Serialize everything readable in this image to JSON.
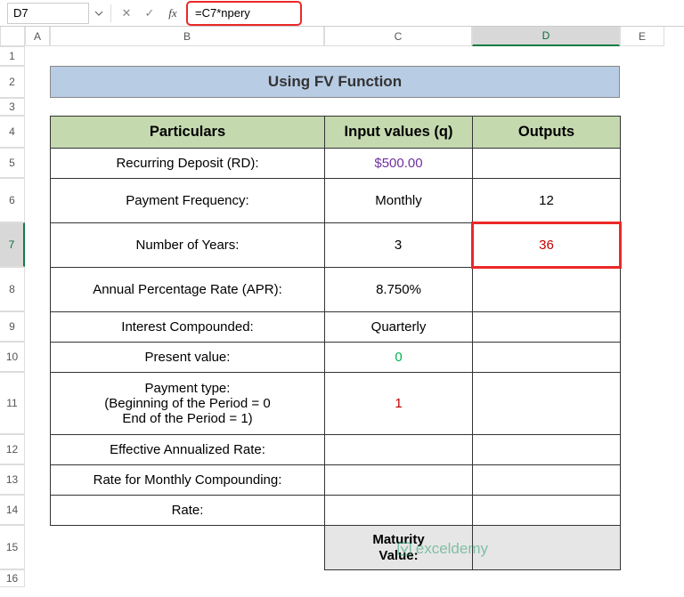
{
  "formula_bar": {
    "cell_ref": "D7",
    "formula": "=C7*npery"
  },
  "col_headers": {
    "A": "A",
    "B": "B",
    "C": "C",
    "D": "D",
    "E": "E"
  },
  "row_headers": [
    "1",
    "2",
    "3",
    "4",
    "5",
    "6",
    "7",
    "8",
    "9",
    "10",
    "11",
    "12",
    "13",
    "14",
    "15",
    "16"
  ],
  "title": "Using FV Function",
  "table": {
    "headers": {
      "particulars": "Particulars",
      "inputs": "Input values (q)",
      "outputs": "Outputs"
    },
    "rows": [
      {
        "label": "Recurring Deposit (RD):",
        "input": "$500.00",
        "output": "",
        "input_class": "purple",
        "h": "r-norm"
      },
      {
        "label": "Payment Frequency:",
        "input": "Monthly",
        "output": "12",
        "input_class": "",
        "h": "r-tall"
      },
      {
        "label": "Number of Years:",
        "input": "3",
        "output": "36",
        "input_class": "",
        "h": "r-tall",
        "active": true
      },
      {
        "label": "Annual Percentage Rate (APR):",
        "input": "8.750%",
        "output": "",
        "input_class": "",
        "h": "r-tall"
      },
      {
        "label": "Interest Compounded:",
        "input": "Quarterly",
        "output": "",
        "input_class": "",
        "h": "r-norm"
      },
      {
        "label": "Present value:",
        "input": "0",
        "output": "",
        "input_class": "green",
        "h": "r-norm"
      },
      {
        "label": "Payment type:\n(Beginning of the Period = 0\nEnd of the Period = 1)",
        "input": "1",
        "output": "",
        "input_class": "red",
        "h": "r-xtall"
      },
      {
        "label": "Effective Annualized Rate:",
        "input": "",
        "output": "",
        "input_class": "",
        "h": "r-norm"
      },
      {
        "label": "Rate for Monthly Compounding:",
        "input": "",
        "output": "",
        "input_class": "",
        "h": "r-norm"
      },
      {
        "label": "Rate:",
        "input": "",
        "output": "",
        "input_class": "",
        "h": "r-norm"
      }
    ],
    "maturity": {
      "label": "Maturity\nValue:",
      "value": ""
    }
  },
  "watermark": "exceldemy",
  "chart_data": {
    "type": "table",
    "title": "Using FV Function",
    "columns": [
      "Particulars",
      "Input values (q)",
      "Outputs"
    ],
    "rows": [
      [
        "Recurring Deposit (RD):",
        "$500.00",
        ""
      ],
      [
        "Payment Frequency:",
        "Monthly",
        "12"
      ],
      [
        "Number of Years:",
        "3",
        "36"
      ],
      [
        "Annual Percentage Rate (APR):",
        "8.750%",
        ""
      ],
      [
        "Interest Compounded:",
        "Quarterly",
        ""
      ],
      [
        "Present value:",
        "0",
        ""
      ],
      [
        "Payment type: (Beginning of the Period = 0 End of the Period = 1)",
        "1",
        ""
      ],
      [
        "Effective Annualized Rate:",
        "",
        ""
      ],
      [
        "Rate for Monthly Compounding:",
        "",
        ""
      ],
      [
        "Rate:",
        "",
        ""
      ],
      [
        "",
        "Maturity Value:",
        ""
      ]
    ]
  }
}
